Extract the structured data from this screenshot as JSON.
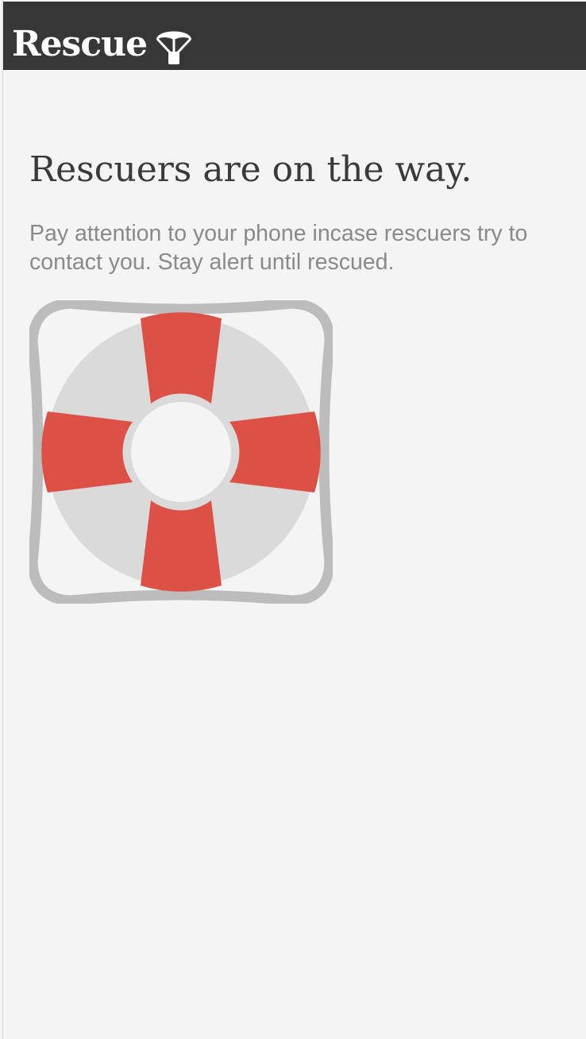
{
  "header": {
    "app_name": "Rescue",
    "logo_icon": "parachute-icon",
    "background_color": "#373737",
    "text_color": "#ffffff"
  },
  "main": {
    "headline": "Rescuers are on the way.",
    "message": "Pay attention to your phone incase rescuers try to contact you. Stay alert until rescued.",
    "illustration_icon": "lifebuoy-icon"
  },
  "colors": {
    "background": "#f4f4f4",
    "lifebuoy_red": "#dc5045",
    "lifebuoy_ring": "#dadada",
    "lifebuoy_rope": "#bcbcbc",
    "headline": "#3a3a3a",
    "body_text": "#8a8a8a"
  }
}
